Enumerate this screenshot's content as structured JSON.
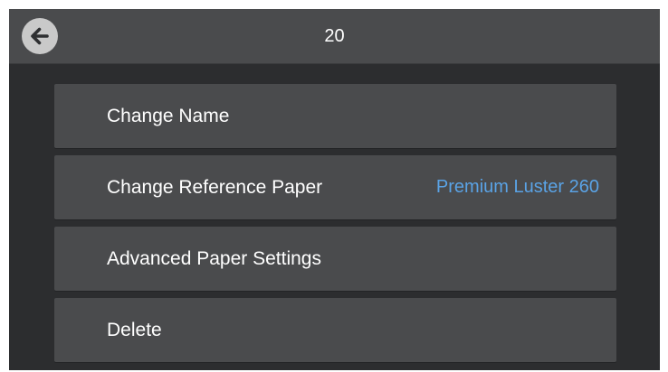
{
  "header": {
    "title": "20",
    "back_icon": "back-arrow-icon"
  },
  "colors": {
    "header_bg": "#4a4b4d",
    "screen_bg": "#2c2d2f",
    "item_bg": "#4a4b4d",
    "value_text": "#5aa3e6"
  },
  "menu": {
    "items": [
      {
        "label": "Change Name",
        "value": ""
      },
      {
        "label": "Change Reference Paper",
        "value": "Premium Luster 260"
      },
      {
        "label": "Advanced Paper Settings",
        "value": ""
      },
      {
        "label": "Delete",
        "value": ""
      }
    ]
  }
}
